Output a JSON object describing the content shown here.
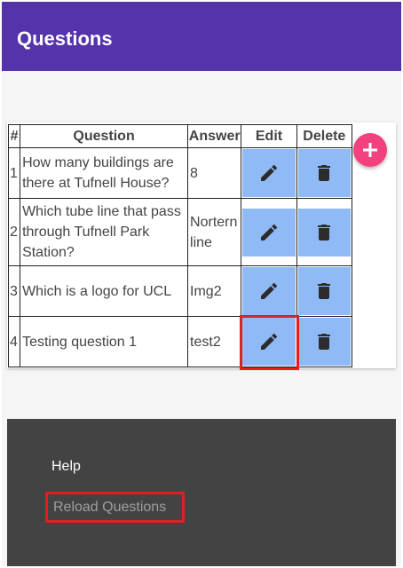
{
  "appbar": {
    "title": "Questions"
  },
  "table": {
    "headers": {
      "num": "#",
      "question": "Question",
      "answer": "Answer",
      "edit": "Edit",
      "delete": "Delete"
    },
    "rows": [
      {
        "num": "1",
        "question": "How many buildings are there at Tufnell House?",
        "answer": "8"
      },
      {
        "num": "2",
        "question": "Which tube line that pass through Tufnell Park Station?",
        "answer": "Nortern line"
      },
      {
        "num": "3",
        "question": "Which is a logo for UCL",
        "answer": "Img2"
      },
      {
        "num": "4",
        "question": "Testing question 1",
        "answer": "test2"
      }
    ]
  },
  "icons": {
    "edit": "pencil-icon",
    "delete": "trash-icon",
    "add": "plus-icon"
  },
  "drawer": {
    "help_label": "Help",
    "reload_label": "Reload Questions"
  },
  "colors": {
    "appbar": "#5533ab",
    "action_button": "#90baf5",
    "fab": "#f2417e",
    "drawer": "#434343",
    "highlight": "#e02020"
  }
}
